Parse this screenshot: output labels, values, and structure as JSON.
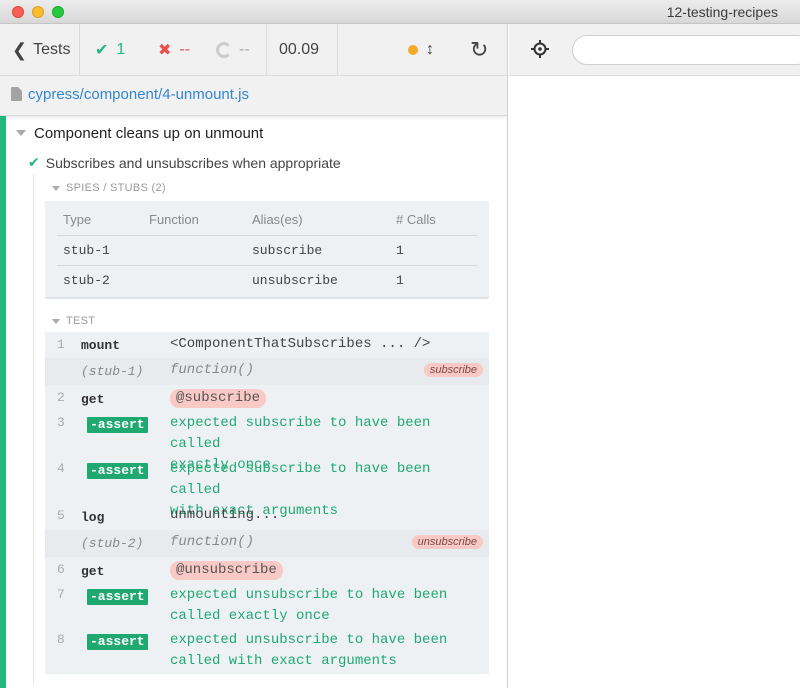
{
  "window": {
    "title": "12-testing-recipes"
  },
  "header": {
    "tests_label": "Tests",
    "passed_count": "1",
    "failed_count": "--",
    "pending_count": "--",
    "duration": "00.09"
  },
  "spec": {
    "path": "cypress/component/4-unmount.js"
  },
  "suite": {
    "title": "Component cleans up on unmount"
  },
  "test": {
    "title": "Subscribes and unsubscribes when appropriate"
  },
  "spies": {
    "header": "SPIES / STUBS (2)",
    "columns": [
      "Type",
      "Function",
      "Alias(es)",
      "# Calls"
    ],
    "rows": [
      {
        "type": "stub-1",
        "function": "",
        "alias": "subscribe",
        "calls": "1"
      },
      {
        "type": "stub-2",
        "function": "",
        "alias": "unsubscribe",
        "calls": "1"
      }
    ]
  },
  "commands": {
    "header": "TEST",
    "items": [
      {
        "num": "1",
        "name": "mount",
        "msg": "<ComponentThatSubscribes ... />"
      },
      {
        "num": "",
        "name": "(stub-1)",
        "msg": "function()",
        "pill": "subscribe"
      },
      {
        "num": "2",
        "name": "get",
        "msg": "@subscribe"
      },
      {
        "num": "3",
        "name": "-assert",
        "msg1": "expected subscribe to have been called",
        "msg2": "exactly once"
      },
      {
        "num": "4",
        "name": "-assert",
        "msg1": "expected subscribe to have been called",
        "msg2": "with exact arguments"
      },
      {
        "num": "5",
        "name": "log",
        "msg": "unmounting..."
      },
      {
        "num": "",
        "name": "(stub-2)",
        "msg": "function()",
        "pill": "unsubscribe"
      },
      {
        "num": "6",
        "name": "get",
        "msg": "@unsubscribe"
      },
      {
        "num": "7",
        "name": "-assert",
        "msg1": "expected unsubscribe to have been",
        "msg2": "called exactly once"
      },
      {
        "num": "8",
        "name": "-assert",
        "msg1": "expected unsubscribe to have been",
        "msg2": "called with exact arguments"
      }
    ]
  },
  "colors": {
    "passed": "#20b87d",
    "failed": "#e94f4f",
    "link": "#3386d4",
    "alias_pill": "#f9c9c5"
  },
  "icons": [
    "chevron-left-icon",
    "check-icon",
    "x-icon",
    "spinner-icon",
    "orange-dot-icon",
    "resize-icon",
    "reload-icon",
    "file-icon",
    "crosshair-icon"
  ]
}
